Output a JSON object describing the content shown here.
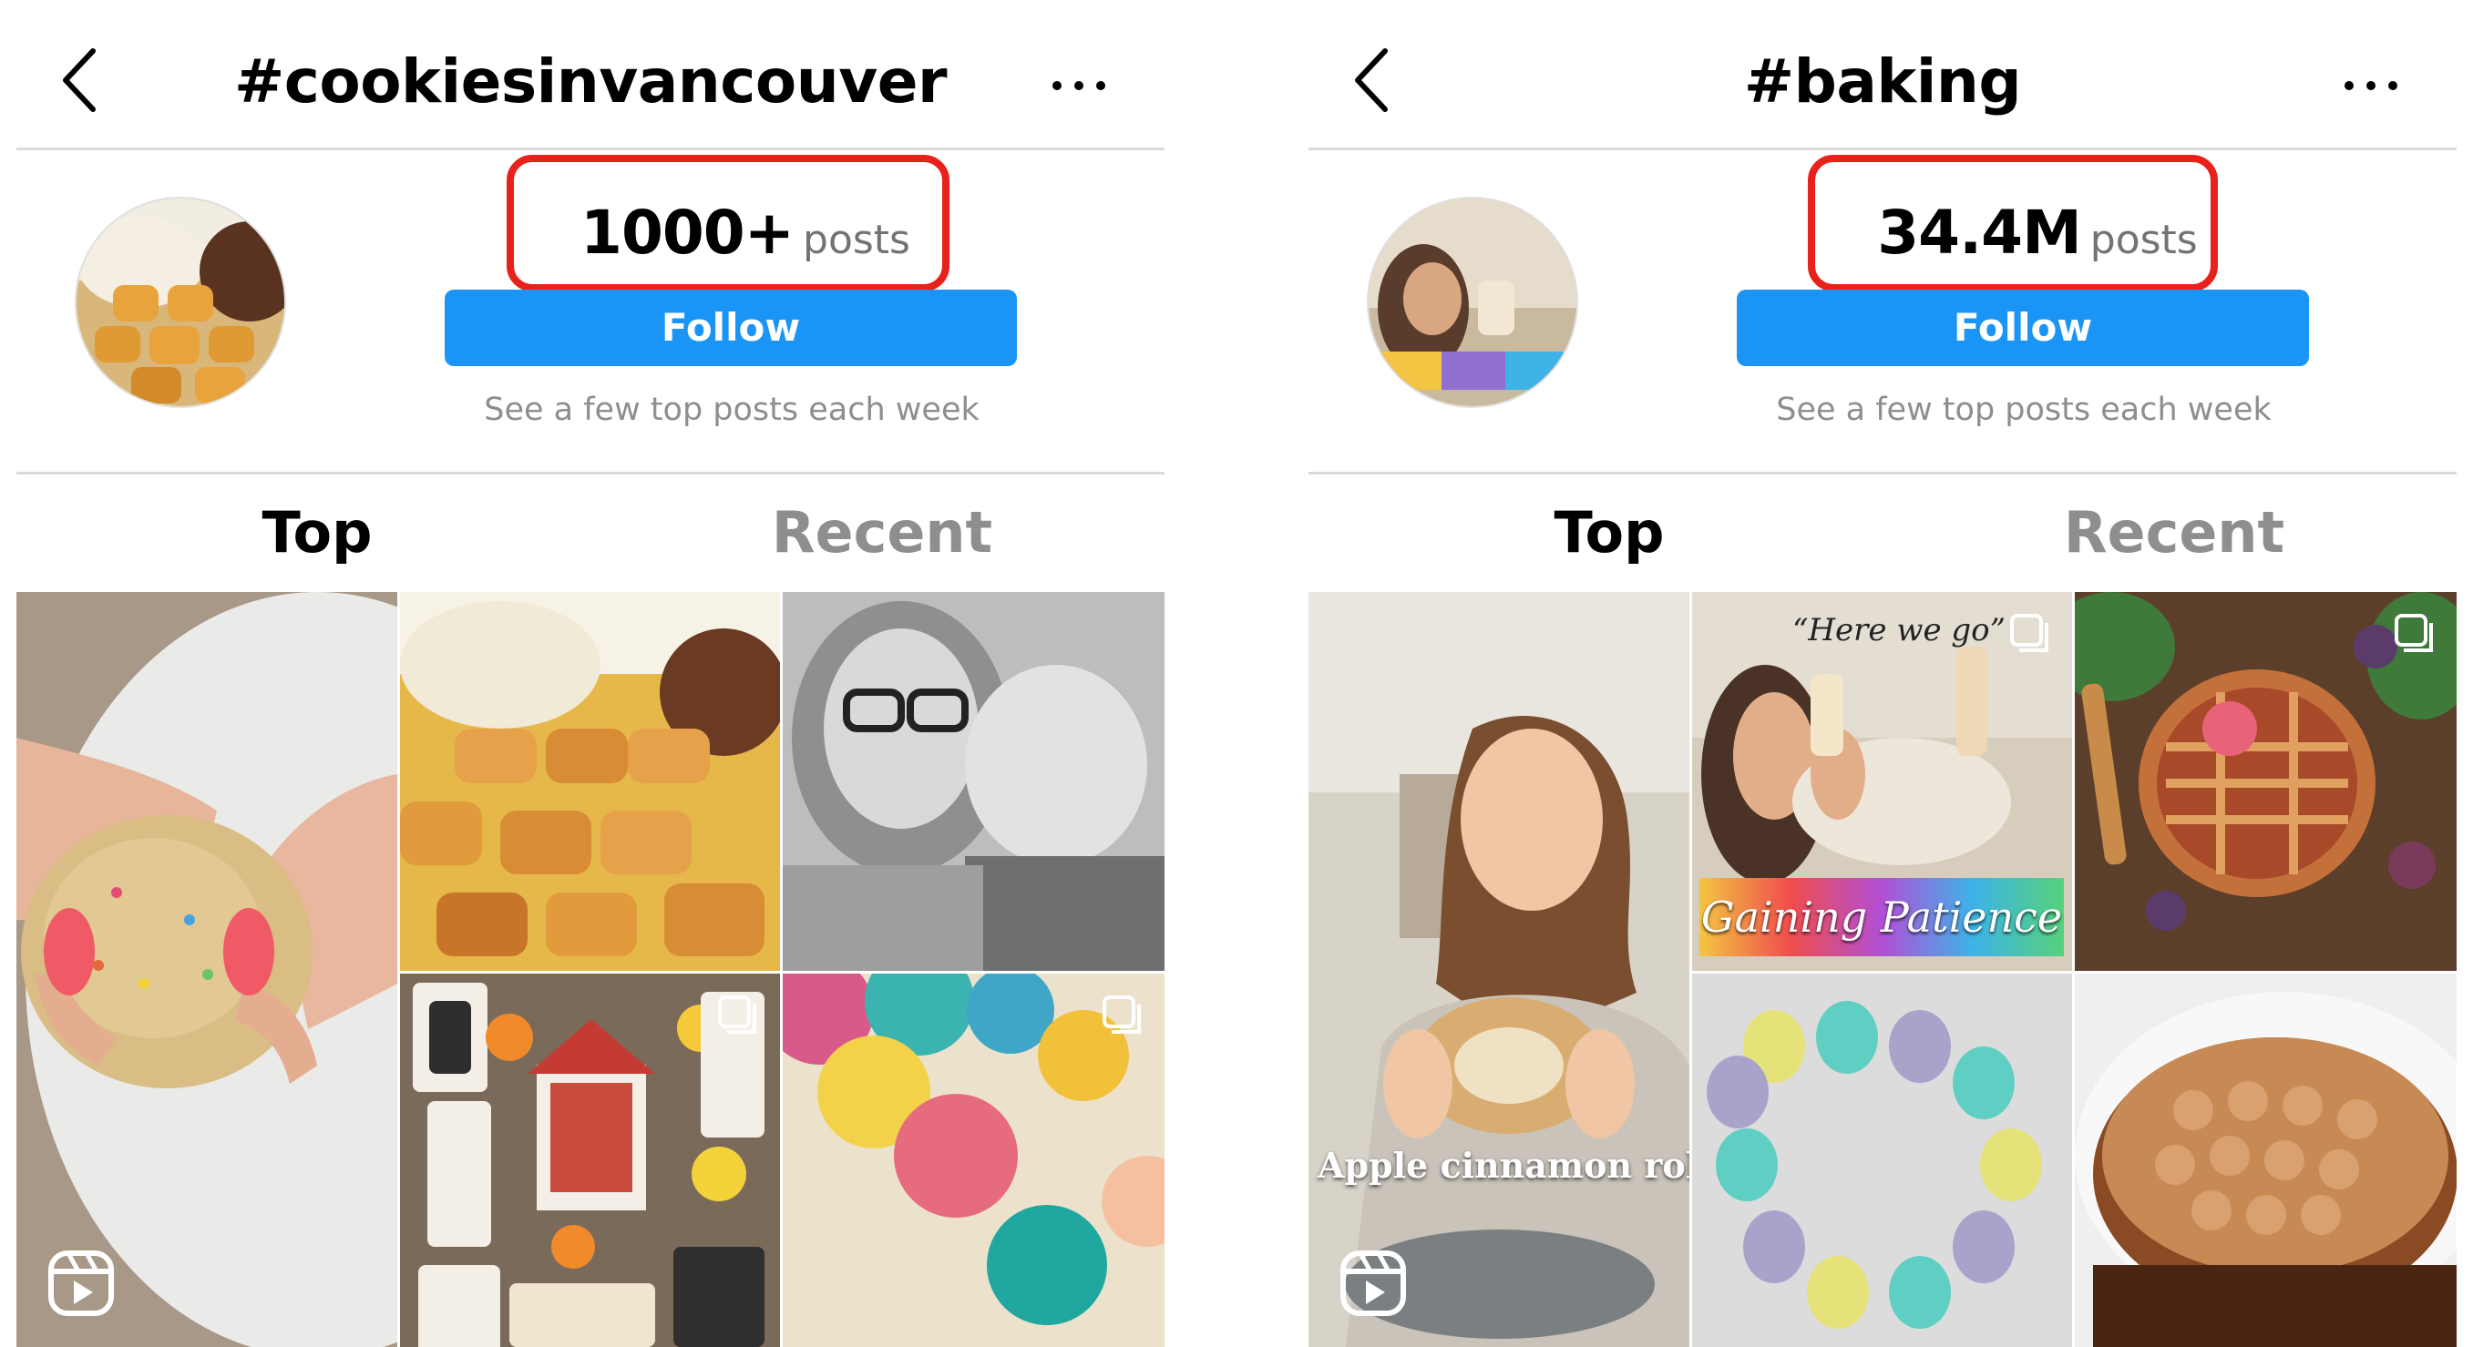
{
  "panels": [
    {
      "hashtag": "#cookiesinvancouver",
      "post_count": "1000+",
      "posts_label": "posts",
      "follow_label": "Follow",
      "caption": "See a few top posts each week",
      "tabs": [
        "Top",
        "Recent"
      ],
      "grid": [
        {
          "subject": "cookie held in hands",
          "badge": "reel-icon"
        },
        {
          "subject": "cake and cookie cups on table"
        },
        {
          "subject": "mother and baby selfie"
        },
        {
          "subject": "decorated house cookies",
          "badge": "carousel-icon"
        },
        {
          "subject": "colorful frosting swirls",
          "badge": "carousel-icon"
        }
      ]
    },
    {
      "hashtag": "#baking",
      "post_count": "34.4M",
      "posts_label": "posts",
      "follow_label": "Follow",
      "caption": "See a few top posts each week",
      "tabs": [
        "Top",
        "Recent"
      ],
      "grid": [
        {
          "subject": "girl holding cinnamon roll",
          "badge": "reel-icon",
          "overlay": "Apple cinnamon rol"
        },
        {
          "subject": "child washing hands",
          "badge": "carousel-icon",
          "overlay": "Gaining Patience",
          "quote": "“Here we go”"
        },
        {
          "subject": "lattice fruit pie",
          "badge": "carousel-icon"
        },
        {
          "subject": "ring of macarons"
        },
        {
          "subject": "chocolate tart"
        }
      ]
    }
  ],
  "colors": {
    "follow_button": "#1a95f5",
    "highlight_box": "#e8211b",
    "secondary_text": "#8e8e8e",
    "divider": "#dbdbdb"
  }
}
